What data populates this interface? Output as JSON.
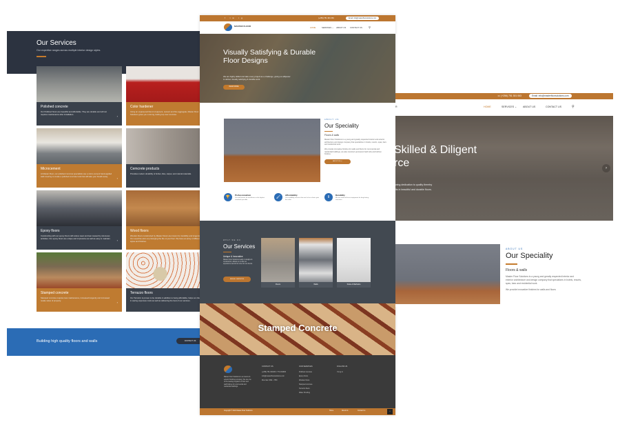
{
  "left_panel": {
    "title": "Our Services",
    "subtitle": "Our expertise ranges across multiple interior design styles.",
    "cards": [
      {
        "title": "Polished concrete",
        "desc": "Our Polished floors are beautiful and affordable. They are durable and will not requires maintenance after installation.",
        "style": "dark"
      },
      {
        "title": "Color hardener",
        "desc": "Using an engineered blend of pigment, cement and fine aggregate, Master Floor Solutions gives you a strong, lasting top over concrete.",
        "style": "orange"
      },
      {
        "title": "Microcement",
        "desc": "At Master Floor, our polished concrete specialists use a micro-cement hand-applied wall covering to create a polished concrete look that will take your breath away.",
        "style": "orange"
      },
      {
        "title": "Cemcrete products",
        "desc": "Provides modern durability of timber, tiles, carpet, and natural materials.",
        "style": "dark"
      },
      {
        "title": "Epoxy floors",
        "desc": "Constructing with our epoxy floors will reduce wear and tear caused by strenuous activities. Our epoxy floors are unique and impressive as well as easy to maintain.",
        "style": "dark"
      },
      {
        "title": "Wood floors",
        "desc": "Wooden floors constructed by Master Floors are known for durability and longevity. Our expertise aims at prolonging the life of your floor. We have an array of different styles and finishes.",
        "style": "orange"
      },
      {
        "title": "Stamped concrete",
        "desc": "Stamped concrete requires less maintenance, increased longevity and increased resale value of property.",
        "style": "orange"
      },
      {
        "title": "Terrazzo floors",
        "desc": "Our Terrazzo is proven to be durable in addition to being affordable, helps our clients in saving expenses costs as well as delivering the best of our services.",
        "style": "dark"
      }
    ],
    "cta": {
      "text": "Building high quality floors and walls",
      "button": "CONTACT US"
    }
  },
  "mid_page": {
    "topbar": {
      "social": "f  tw  ig",
      "phone": "(+256) 751 301 063",
      "email": "Email: info@masterfloorsolutions.com"
    },
    "logo_text": "MASTER FLOOR",
    "menu": [
      "HOME",
      "SERVICES ⌄",
      "ABOUT US",
      "CONTACT US"
    ],
    "hero": {
      "title": "Visually Satisfying & Durable Floor Designs",
      "desc": "We are highly skilled and take every project as a challenge, giving us willpower to deliver visually satisfying & durable work.",
      "button": "READ MORE"
    },
    "speciality": {
      "kicker": "ABOUT US",
      "title": "Our Speciality",
      "subtitle": "Floors & walls",
      "p1": "Master Floor Solutions is a young and greatly respected interior and exterior architecture and design company that specializes in hotels, resorts, spas, bars and residential work.",
      "p2": "We provide innovative finishes for walls and floors for commercial and residential buildings, we also construct permanent bath tubs and kitchen finishes.",
      "button": "ABOUT US  |  ›"
    },
    "features": [
      {
        "icon": "trophy-icon",
        "glyph": "🏆",
        "title": "Professionalism",
        "desc": "Our staff strives for excellence in the highest standards possible"
      },
      {
        "icon": "paint-roller-icon",
        "glyph": "🖌",
        "title": "Affordability",
        "desc": "Our credibility ensures that each of our clients gets the value"
      },
      {
        "icon": "durability-icon",
        "glyph": "⦀",
        "title": "Durability",
        "desc": "We use state-of-the-art equipment for long-lasting structures"
      }
    ],
    "services": {
      "kicker": "WHAT WE DO",
      "title": "Our Services",
      "subtitle": "Unique & Innovative",
      "desc": "Master Floor Solutions leads in designs & construction, allows us to offer an experience second to none for our clients.",
      "button": "SEE ALL SERVICES",
      "tiles": [
        "Floors",
        "Walls",
        "Sinks & Bathtubs"
      ]
    },
    "stamped_banner": "Stamped Concrete",
    "footer": {
      "about": "Master Floor Solutions is an interior & exterior finishing company. We are one of the leading suppliers of floor and wall finishes for commercial and residential buildings.",
      "contact_heading": "CONTACT US",
      "contacts": [
        "(+256) 751 301063 / 774 462936",
        "info@masterfloorsolutions.com",
        "Mon-Sat: 8AM - 7PM"
      ],
      "services_heading": "OUR SERVICES",
      "services": [
        "Polished concrete",
        "Epoxy floors",
        "Wooden floors",
        "Stamped concrete",
        "Terrazzo floors",
        "Water Proofing"
      ],
      "follow_heading": "FOLLOW US",
      "follow": "f  tw  ig  in"
    },
    "copyright": "Copyright © 2021 Master Floor Solutions",
    "footer_links": [
      "Home",
      "About Us",
      "Contact Us"
    ]
  },
  "right_page": {
    "phone": "☏  (+256) 751 301 063",
    "email": "Email: info@masterfloorsolutions.com",
    "logo_partial": "R",
    "menu": [
      "HOME",
      "SERVICES ⌄",
      "ABOUT US",
      "CONTACT US"
    ],
    "hero": {
      "title": "Skilled & Diligent\nrce",
      "line1": "Skilled & Diligent",
      "line2": "rce",
      "desc1": "wing dedication to quality thereby",
      "desc2": "lts in beautiful and durable floors."
    },
    "speciality": {
      "kicker": "ABOUT US",
      "title": "Our Speciality",
      "subtitle": "Floors & walls",
      "p1": "Master Floor Solutions is a young and greatly respected interior and exterior architecture and design company that specializes in hotels, resorts, spas, bars and residential work.",
      "p2": "We provide innovative finishes for walls and floors"
    }
  }
}
